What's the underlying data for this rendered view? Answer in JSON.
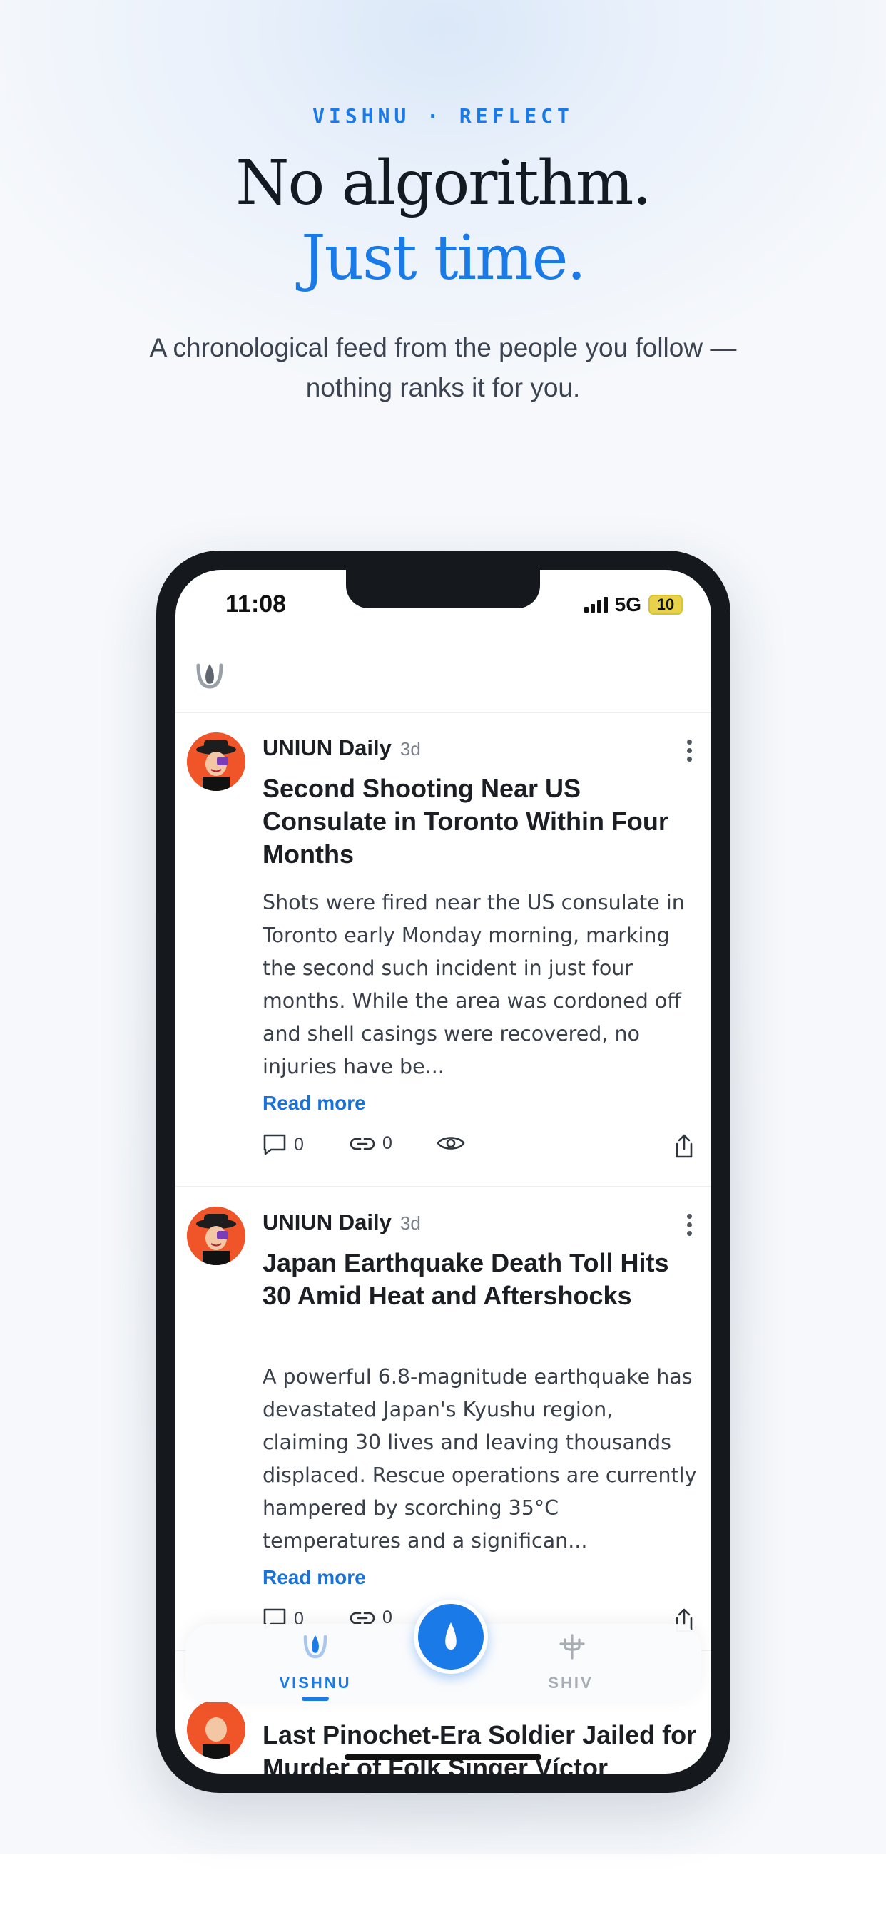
{
  "hero": {
    "eyebrow": "VISHNU · REFLECT",
    "headline_1": "No algorithm.",
    "headline_2": "Just time.",
    "subtitle": "A chronological feed from the people you follow — nothing ranks it for you."
  },
  "status_bar": {
    "time": "11:08",
    "network": "5G",
    "battery": "10"
  },
  "app": {
    "logo_icon": "vishnu-logo-icon"
  },
  "posts": [
    {
      "author": "UNIUN Daily",
      "age": "3d",
      "title": "Second Shooting Near US Consulate in Toronto Within Four Months",
      "body": "Shots were fired near the US consulate in Toronto early Monday morning, marking the second such incident in just four months. While the area was cordoned off and shell casings were recovered, no injuries have be...",
      "read_more": "Read more",
      "comments": "0",
      "links": "0"
    },
    {
      "author": "UNIUN Daily",
      "age": "3d",
      "title": "Japan Earthquake Death Toll Hits 30 Amid Heat and Aftershocks",
      "body": "A powerful 6.8-magnitude earthquake has devastated Japan's Kyushu region, claiming 30 lives and leaving thousands displaced. Rescue operations are currently hampered by scorching 35°C temperatures and a significan...",
      "read_more": "Read more",
      "comments": "0",
      "links": "0"
    },
    {
      "title": "Last Pinochet-Era Soldier Jailed for Murder of Folk Singer Víctor"
    }
  ],
  "tabbar": {
    "left_label": "VISHNU",
    "right_label": "SHIV",
    "accent": "#1a7ae8"
  }
}
